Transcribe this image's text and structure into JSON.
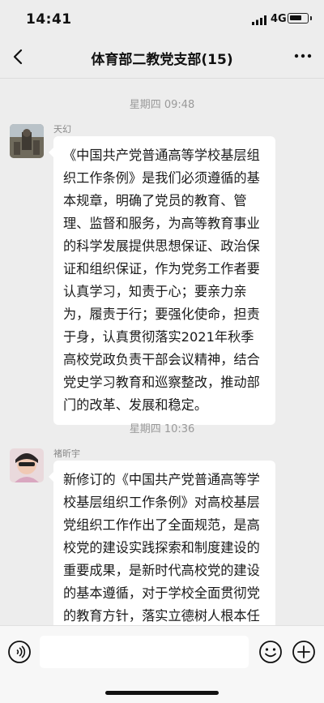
{
  "status_bar": {
    "time": "14:41",
    "network": "4G"
  },
  "header": {
    "title": "体育部二教党支部(15)"
  },
  "messages": [
    {
      "timestamp": "星期四 09:48",
      "sender": "天幻",
      "text": "《中国共产党普通高等学校基层组织工作条例》是我们必须遵循的基本规章，明确了党员的教育、管理、监督和服务，为高等教育事业的科学发展提供思想保证、政治保证和组织保证，作为党务工作者要认真学习，知责于心；要亲力亲为，履责于行；要强化使命，担责于身，认真贯彻落实2021年秋季高校党政负责干部会议精神，结合党史学习教育和巡察整改，推动部门的改革、发展和稳定。"
    },
    {
      "timestamp": "星期四 10:36",
      "sender": "褚昕宇",
      "text": "新修订的《中国共产党普通高等学校基层组织工作条例》对高校基层党组织工作作出了全面规范，是高校党的建设实践探索和制度建设的重要成果，是新时代高校党的建设的基本遵循，对于学校全面贯彻党的教育方针，落实立德树人根本任务，建设高质量教育体系，培养社会主义建设"
    }
  ],
  "input_bar": {
    "placeholder": ""
  },
  "colors": {
    "background": "#ededed",
    "bubble": "#ffffff",
    "timestamp": "#9a9a9a"
  }
}
